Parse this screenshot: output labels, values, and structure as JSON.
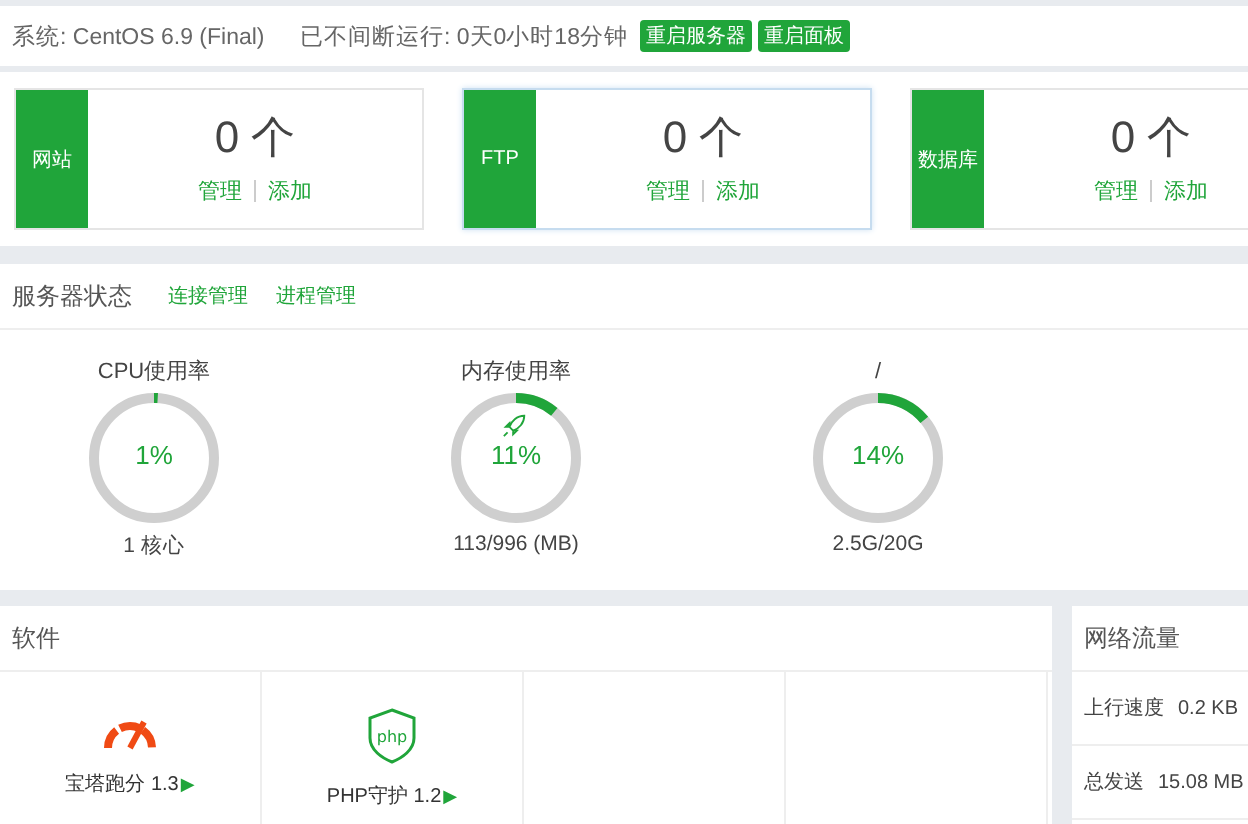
{
  "top_bar": {
    "system": "系统: CentOS 6.9 (Final)",
    "uptime": "已不间断运行: 0天0小时18分钟",
    "buttons": [
      "重启服务器",
      "重启面板"
    ]
  },
  "summary_cards": [
    {
      "label": "网站",
      "count": "0 个",
      "links": [
        "管理",
        "添加"
      ],
      "selected": false
    },
    {
      "label": "FTP",
      "count": "0 个",
      "links": [
        "管理",
        "添加"
      ],
      "selected": true
    },
    {
      "label": "数据库",
      "count": "0 个",
      "links": [
        "管理",
        "添加"
      ],
      "selected": false
    }
  ],
  "server_status": {
    "title": "服务器状态",
    "links": [
      "连接管理",
      "进程管理"
    ],
    "gauges": [
      {
        "title": "CPU使用率",
        "reading": "1%",
        "level": 0.01,
        "detail": "1 核心",
        "kind": "plain"
      },
      {
        "title": "内存使用率",
        "reading": "11%",
        "level": 0.11,
        "detail": "113/996 (MB)",
        "kind": "boost"
      },
      {
        "title": "/",
        "reading": "14%",
        "level": 0.14,
        "detail": "2.5G/20G",
        "kind": "plain"
      }
    ]
  },
  "software": {
    "title": "软件",
    "items": [
      {
        "kind": "gauge",
        "name": "宝塔跑分 1.3",
        "arrow": "▶"
      },
      {
        "kind": "php",
        "name": "PHP守护 1.2",
        "arrow": "▶"
      },
      {
        "kind": "empty"
      },
      {
        "kind": "empty"
      }
    ]
  },
  "network": {
    "title": "网络流量",
    "rows": [
      {
        "label": "上行速度",
        "value": "0.2 KB"
      },
      {
        "label": "总发送",
        "value": "15.08 MB"
      }
    ]
  }
}
